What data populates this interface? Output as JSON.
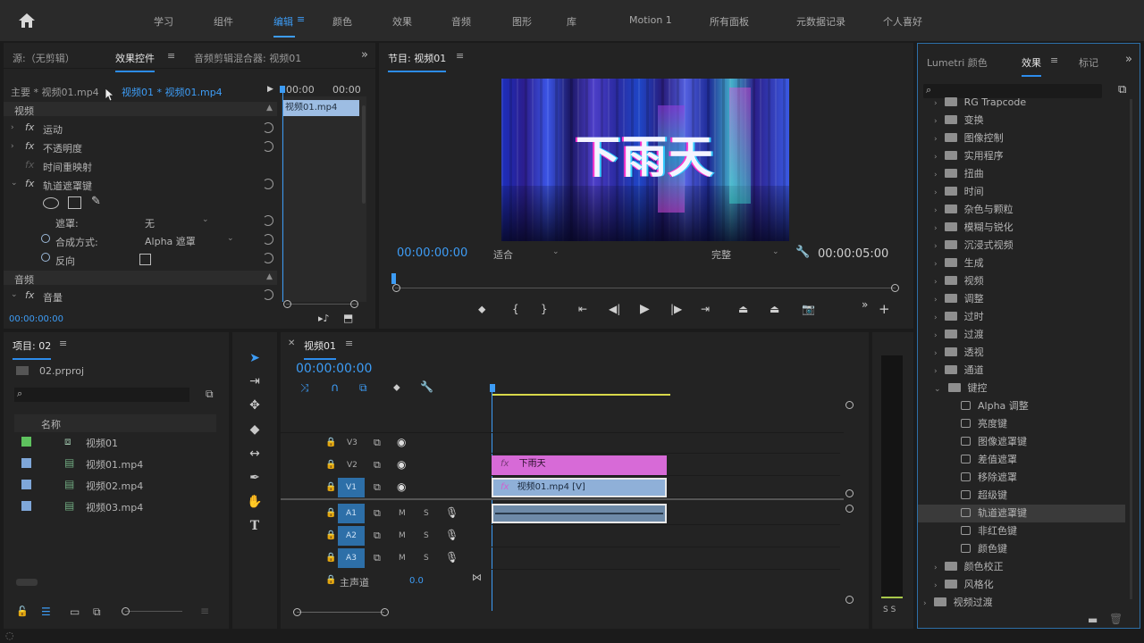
{
  "workspace_bar": {
    "items": [
      "学习",
      "组件",
      "编辑",
      "颜色",
      "效果",
      "音频",
      "图形",
      "库",
      "Motion 1",
      "所有面板",
      "元数据记录",
      "个人喜好"
    ],
    "active_index": 2
  },
  "effect_controls": {
    "tabs": [
      "源:（无剪辑）",
      "效果控件",
      "音频剪辑混合器: 视频01"
    ],
    "active_tab": 1,
    "master_label": "主要 * 视频01.mp4",
    "clip_label": "视频01 * 视频01.mp4",
    "time_start": "00:00",
    "time_end": "00:00",
    "mini_clip": "视频01.mp4",
    "section_video": "视频",
    "fx_motion": "运动",
    "fx_opacity": "不透明度",
    "fx_timeremap": "时间重映射",
    "fx_trackmatte": "轨道遮罩键",
    "matte_label": "遮罩:",
    "matte_value": "无",
    "composite_label": "合成方式:",
    "composite_value": "Alpha 遮罩",
    "reverse_label": "反向",
    "section_audio": "音频",
    "fx_volume": "音量",
    "timecode": "00:00:00:00"
  },
  "program_monitor": {
    "title": "节目: 视频01",
    "video_text": "下雨天",
    "timecode": "00:00:00:00",
    "fit": "适合",
    "quality": "完整",
    "duration": "00:00:05:00"
  },
  "effects_panel": {
    "tabs": [
      "Lumetri 颜色",
      "效果",
      "标记"
    ],
    "active_tab": 1,
    "folders_top": [
      "RG Trapcode",
      "变换",
      "图像控制",
      "实用程序",
      "扭曲",
      "时间",
      "杂色与颗粒",
      "模糊与锐化",
      "沉浸式视频",
      "生成",
      "视频",
      "调整",
      "过时",
      "过渡",
      "透视",
      "通道",
      "键控"
    ],
    "keying_items": [
      "Alpha 调整",
      "亮度键",
      "图像遮罩键",
      "差值遮罩",
      "移除遮罩",
      "超级键",
      "轨道遮罩键",
      "非红色键",
      "颜色键"
    ],
    "selected_item": "轨道遮罩键",
    "folders_bottom": [
      "颜色校正",
      "风格化"
    ],
    "video_transitions": "视频过渡"
  },
  "project_panel": {
    "title": "项目: 02",
    "file": "02.prproj",
    "col_name": "名称",
    "items": [
      {
        "name": "视频01",
        "color": "#5ec25e"
      },
      {
        "name": "视频01.mp4",
        "color": "#7fa7d9"
      },
      {
        "name": "视频02.mp4",
        "color": "#7fa7d9"
      },
      {
        "name": "视频03.mp4",
        "color": "#7fa7d9"
      }
    ]
  },
  "timeline": {
    "title": "视频01",
    "timecode": "00:00:00:00",
    "video_tracks": [
      "V3",
      "V2",
      "V1"
    ],
    "audio_tracks": [
      "A1",
      "A2",
      "A3"
    ],
    "mute": "M",
    "solo": "S",
    "master_label": "主声道",
    "master_value": "0.0",
    "clip_v2": "下雨天",
    "clip_v1": "视频01.mp4 [V]",
    "fx_badge": "fx"
  },
  "audio_meter": {
    "label": "S S"
  },
  "colors": {
    "accent": "#2d8ceb",
    "clip_pink": "#d76ad7",
    "clip_blue": "#8fb0d8",
    "track_blue": "#2d6fa8"
  }
}
